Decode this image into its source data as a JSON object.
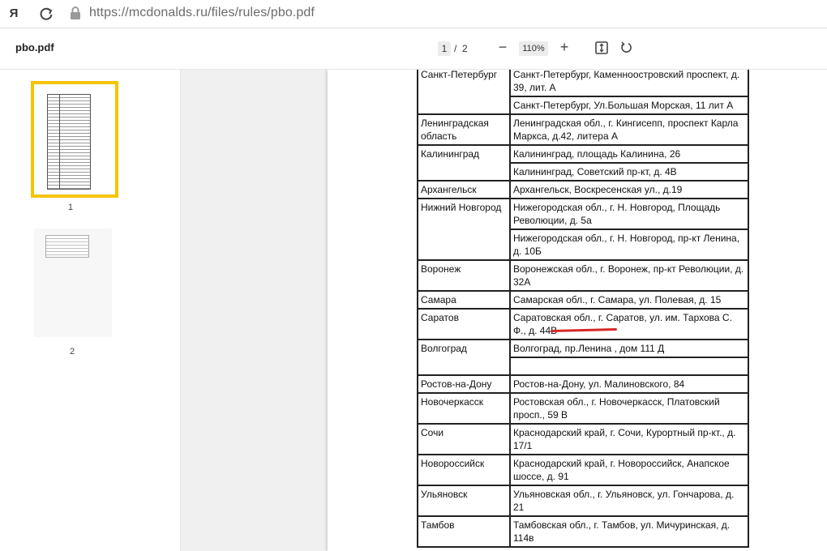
{
  "browser": {
    "yandex_button": "Я",
    "url": "https://mcdonalds.ru/files/rules/pbo.pdf"
  },
  "toolbar": {
    "filename": "pbo.pdf",
    "current_page": "1",
    "separator": "/",
    "total_pages": "2",
    "zoom": "110%",
    "zoom_out": "−",
    "zoom_in": "+"
  },
  "sidebar": {
    "thumbs": [
      {
        "label": "1",
        "selected": true
      },
      {
        "label": "2",
        "selected": false
      }
    ],
    "selected_color": "#f5c400"
  },
  "table": {
    "rows": [
      {
        "city": "Санкт-Петербург",
        "addresses": [
          "Санкт-Петербург, Каменноостровский проспект, д. 39, лит. А",
          "Санкт-Петербург, Ул.Большая Морская, 11 лит А"
        ]
      },
      {
        "city": "Ленинградская область",
        "addresses": [
          "Ленинградская обл., г. Кингисепп, проспект Карла Маркса, д.42, литера А"
        ]
      },
      {
        "city": "Калининград",
        "addresses": [
          "Калининград, площадь Калинина, 26",
          "Калининград, Советский пр-кт, д. 4В"
        ]
      },
      {
        "city": "Архангельск",
        "addresses": [
          "Архангельск, Воскресенская ул., д.19"
        ]
      },
      {
        "city": "Нижний Новгород",
        "addresses": [
          "Нижегородская обл., г. Н. Новгород, Площадь Революции, д. 5а",
          "Нижегородская обл., г. Н. Новгород, пр-кт Ленина, д. 10Б"
        ]
      },
      {
        "city": "Воронеж",
        "addresses": [
          "Воронежская обл., г. Воронеж, пр-кт Революции, д. 32А"
        ]
      },
      {
        "city": "Самара",
        "addresses": [
          "Самарская обл., г. Самара, ул. Полевая, д. 15"
        ]
      },
      {
        "city": "Саратов",
        "addresses": [
          "Саратовская обл., г. Саратов, ул. им. Тархова С. Ф., д. 44В"
        ]
      },
      {
        "city": "Волгоград",
        "addresses": [
          "Волгоград, пр.Ленина , дом 111 Д",
          ""
        ]
      },
      {
        "city": "Ростов-на-Дону",
        "addresses": [
          "Ростов-на-Дону, ул. Малиновского, 84"
        ]
      },
      {
        "city": "Новочеркасск",
        "addresses": [
          "Ростовская обл., г. Новочеркасск, Платовский просп., 59 В"
        ]
      },
      {
        "city": "Сочи",
        "addresses": [
          "Краснодарский край, г. Сочи, Курортный пр-кт., д. 17/1"
        ]
      },
      {
        "city": "Новороссийск",
        "addresses": [
          "Краснодарский край, г. Новороссийск, Анапское шоссе, д. 91"
        ]
      },
      {
        "city": "Ульяновск",
        "addresses": [
          "Ульяновская обл., г. Ульяновск, ул. Гончарова, д. 21"
        ]
      },
      {
        "city": "Тамбов",
        "addresses": [
          "Тамбовская обл., г. Тамбов, ул. Мичуринская, д. 114в"
        ]
      }
    ],
    "highlight_color": "#d62828"
  }
}
